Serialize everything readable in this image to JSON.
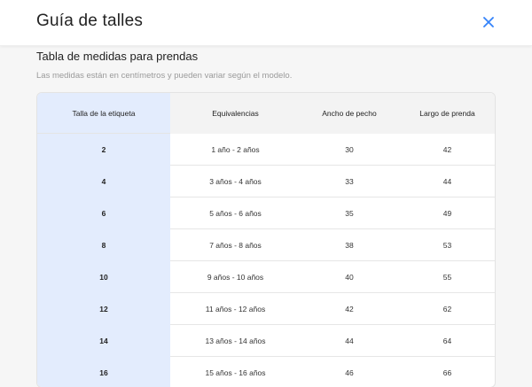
{
  "header": {
    "title": "Guía de talles"
  },
  "section": {
    "title": "Tabla de medidas para prendas",
    "subtitle": "Las medidas están en centímetros y pueden variar según el modelo."
  },
  "table": {
    "columns": [
      "Talla de la etiqueta",
      "Equivalencias",
      "Ancho de pecho",
      "Largo de prenda"
    ],
    "rows": [
      [
        "2",
        "1 año - 2 años",
        "30",
        "42"
      ],
      [
        "4",
        "3 años - 4 años",
        "33",
        "44"
      ],
      [
        "6",
        "5 años - 6 años",
        "35",
        "49"
      ],
      [
        "8",
        "7 años - 8 años",
        "38",
        "53"
      ],
      [
        "10",
        "9 años - 10 años",
        "40",
        "55"
      ],
      [
        "12",
        "11 años - 12 años",
        "42",
        "62"
      ],
      [
        "14",
        "13 años - 14 años",
        "44",
        "64"
      ],
      [
        "16",
        "15 años - 16 años",
        "46",
        "66"
      ]
    ]
  },
  "icons": {
    "close": "close-icon"
  },
  "colors": {
    "accent": "#3483fa",
    "first_column": "#e3ecfd"
  }
}
